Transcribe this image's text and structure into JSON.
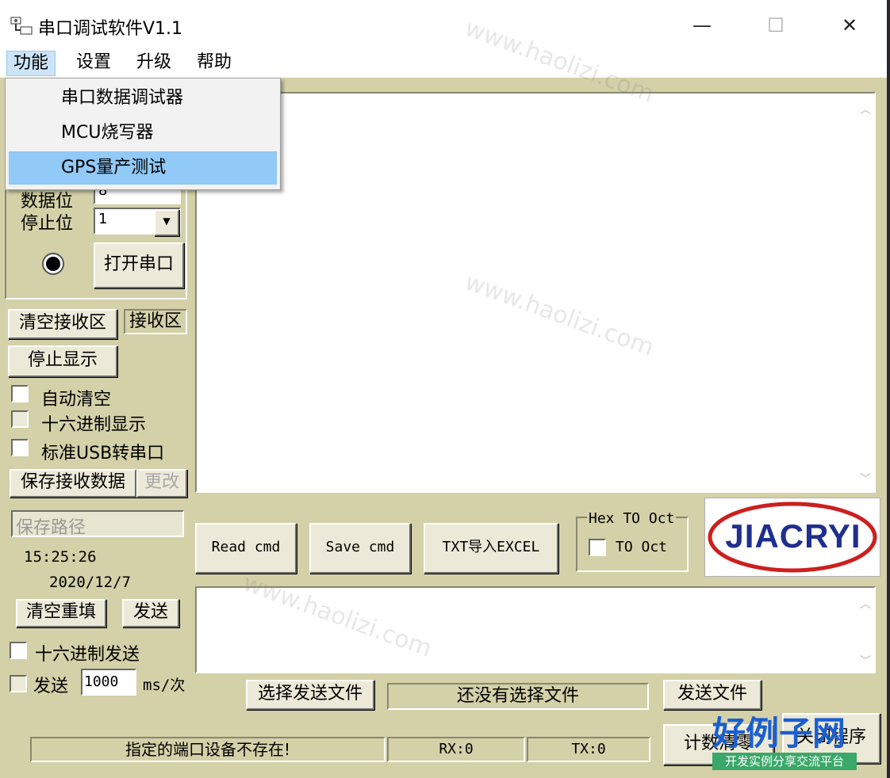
{
  "window": {
    "title": "串口调试软件V1.1",
    "min": "—",
    "max": "☐",
    "close": "✕"
  },
  "menubar": {
    "items": [
      "功能",
      "设置",
      "升级",
      "帮助"
    ]
  },
  "dropdown": {
    "items": [
      "串口数据调试器",
      "MCU烧写器",
      "GPS量产测试"
    ],
    "highlighted_index": 2
  },
  "serial": {
    "databits_label": "数据位",
    "databits_value": "8",
    "stopbits_label": "停止位",
    "stopbits_value": "1",
    "open_button": "打开串口"
  },
  "receive": {
    "clear_button": "清空接收区",
    "area_label": "接收区",
    "stop_display_button": "停止显示",
    "auto_clear": "自动清空",
    "hex_display": "十六进制显示",
    "usb_serial": "标准USB转串口",
    "save_button": "保存接收数据",
    "change_button": "更改",
    "save_path_placeholder": "保存路径"
  },
  "clock": {
    "time": "15:25:26",
    "date": "2020/12/7"
  },
  "send": {
    "clear_button": "清空重填",
    "send_button": "发送",
    "hex_send": "十六进制发送",
    "auto_send_label": "发送",
    "interval_value": "1000",
    "interval_unit": "ms/次"
  },
  "cmd_buttons": {
    "read": "Read cmd",
    "save": "Save cmd",
    "txt_excel": "TXT导入EXCEL"
  },
  "hex_oct": {
    "group_label": "Hex TO Oct",
    "checkbox_label": "TO Oct"
  },
  "logo": {
    "text": "JIACRYI"
  },
  "file": {
    "select_button": "选择发送文件",
    "status": "还没有选择文件",
    "send_button": "发送文件"
  },
  "status": {
    "message": "指定的端口设备不存在!",
    "rx": "RX:0",
    "tx": "TX:0",
    "count_clear_button": "计数清零",
    "close_button": "关闭程序"
  },
  "watermark": {
    "logo_text": "好例子网",
    "slogan": "开发实例分享交流平台",
    "url_repeat": "www.haolizi.com"
  },
  "colors": {
    "panel": "#d4d0a8",
    "menu_highlight": "#91c9f7",
    "logo_red": "#cc1f1f",
    "logo_blue": "#1f2f8f"
  }
}
